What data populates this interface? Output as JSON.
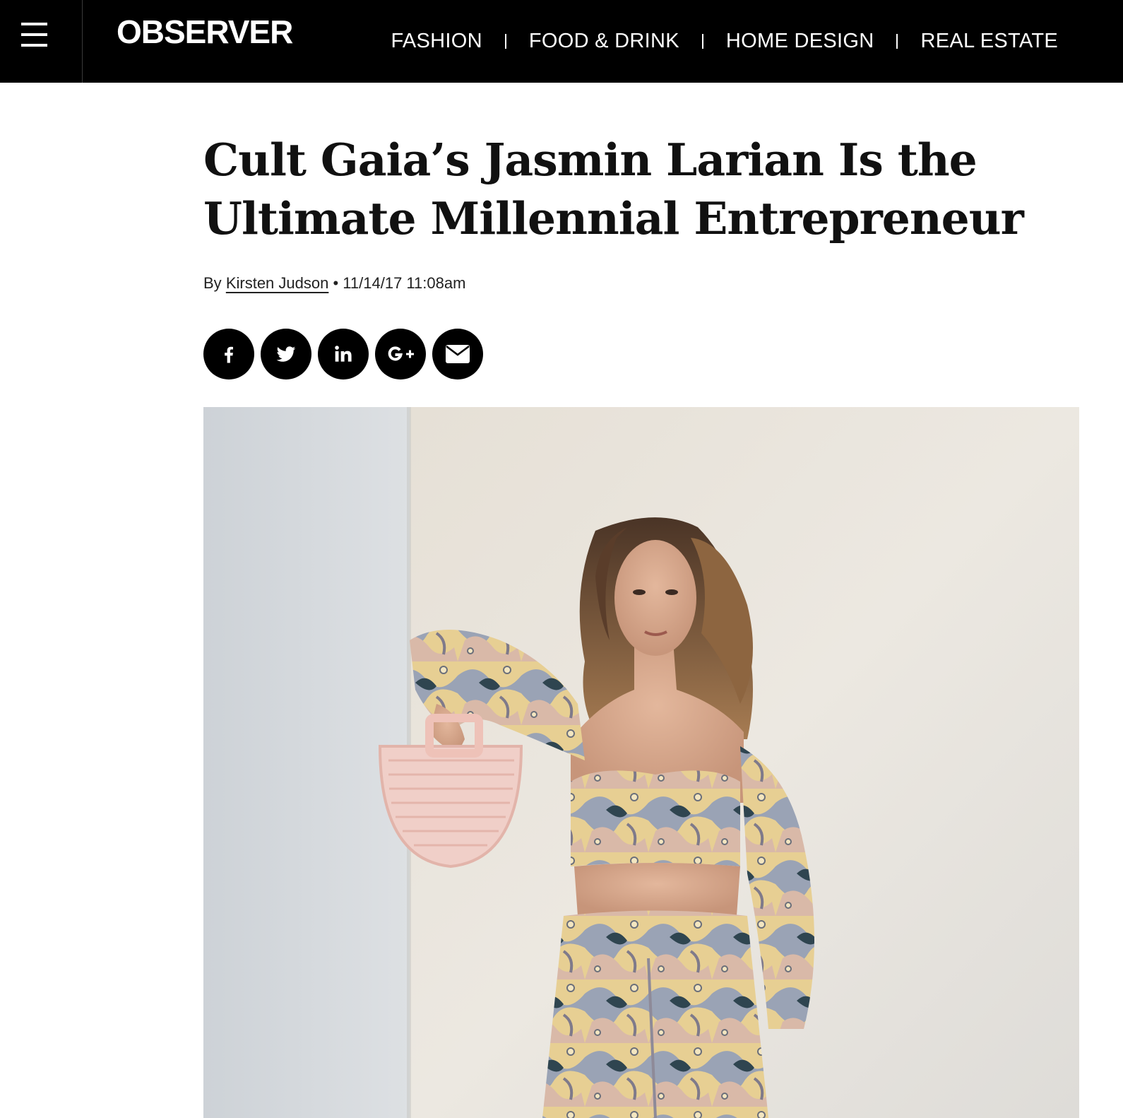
{
  "header": {
    "menu_icon": "hamburger-menu-icon",
    "logo": "OBSERVER",
    "nav": [
      {
        "label": "FASHION"
      },
      {
        "label": "FOOD & DRINK"
      },
      {
        "label": "HOME DESIGN"
      },
      {
        "label": "REAL ESTATE"
      }
    ]
  },
  "article": {
    "title": "Cult Gaia’s Jasmin Larian Is the Ultimate Millennial Entrepreneur",
    "byline_prefix": "By",
    "author": "Kirsten Judson",
    "separator": "•",
    "date": "11/14/17 11:08am"
  },
  "share": [
    {
      "network": "facebook",
      "icon": "facebook-icon"
    },
    {
      "network": "twitter",
      "icon": "twitter-icon"
    },
    {
      "network": "linkedin",
      "icon": "linkedin-icon"
    },
    {
      "network": "google-plus",
      "icon": "google-plus-icon"
    },
    {
      "network": "email",
      "icon": "email-icon"
    }
  ],
  "colors": {
    "topbar_bg": "#000000",
    "text": "#111111",
    "share_bg": "#000000"
  }
}
